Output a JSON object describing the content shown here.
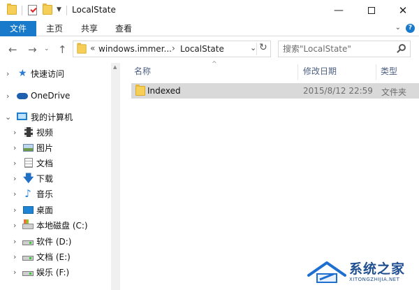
{
  "window": {
    "title": "LocalState",
    "minimize_icon": "minimize-icon",
    "maximize_icon": "maximize-icon",
    "close_icon": "close-icon"
  },
  "ribbon": {
    "tabs": [
      {
        "label": "文件",
        "active": true
      },
      {
        "label": "主页"
      },
      {
        "label": "共享"
      },
      {
        "label": "查看"
      }
    ],
    "accent": "#1979ca"
  },
  "address": {
    "prefix": "«",
    "segments": [
      "windows.immer...",
      "LocalState"
    ]
  },
  "search": {
    "placeholder": "搜索\"LocalState\""
  },
  "nav": {
    "items": [
      {
        "label": "快速访问",
        "icon": "star-icon"
      },
      {
        "label": "OneDrive",
        "icon": "cloud-icon"
      },
      {
        "label": "我的计算机",
        "icon": "pc-icon"
      },
      {
        "label": "视频",
        "icon": "video-icon"
      },
      {
        "label": "图片",
        "icon": "picture-icon"
      },
      {
        "label": "文档",
        "icon": "doc-icon"
      },
      {
        "label": "下载",
        "icon": "download-icon"
      },
      {
        "label": "音乐",
        "icon": "music-icon"
      },
      {
        "label": "桌面",
        "icon": "desktop-icon"
      },
      {
        "label": "本地磁盘 (C:)",
        "icon": "cdrive-icon"
      },
      {
        "label": "软件 (D:)",
        "icon": "drive-icon"
      },
      {
        "label": "文档 (E:)",
        "icon": "drive-icon"
      },
      {
        "label": "娱乐 (F:)",
        "icon": "drive-icon"
      }
    ]
  },
  "columns": {
    "name": "名称",
    "modified": "修改日期",
    "type": "类型"
  },
  "files": [
    {
      "name": "Indexed",
      "modified": "2015/8/12 22:59",
      "type": "文件夹",
      "selected": true
    }
  ],
  "watermark": {
    "text": "系统之家",
    "sub": "XITONGZHIJIA.NET"
  }
}
